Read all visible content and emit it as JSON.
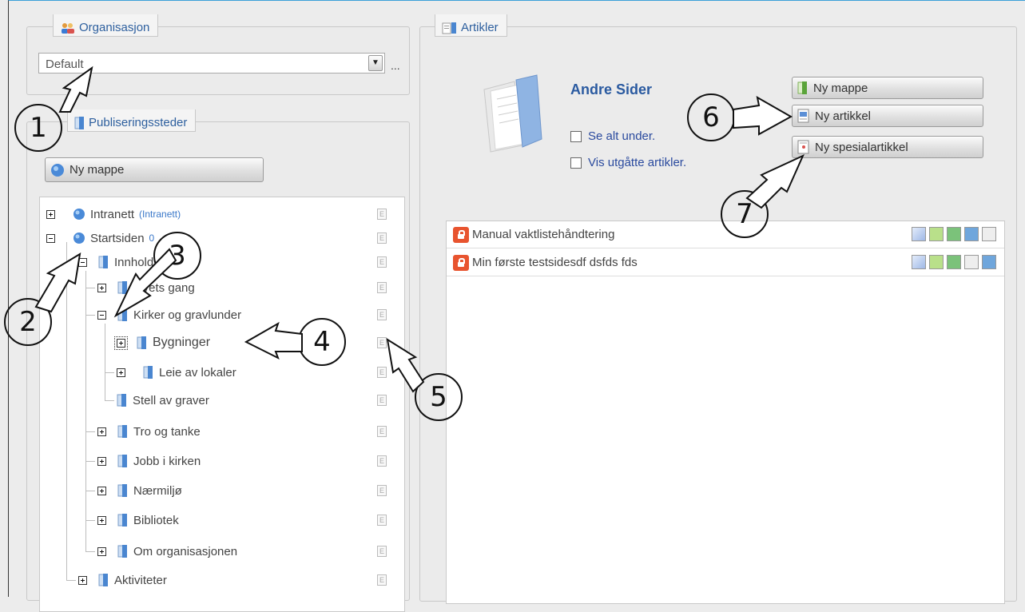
{
  "organisation": {
    "legend": "Organisasjon",
    "selected": "Default",
    "more": "..."
  },
  "publishing": {
    "legend": "Publiseringssteder",
    "new_folder_label": "Ny mappe",
    "tree": [
      {
        "label": "Intranett",
        "suffix": "(Intranett)",
        "toggle": "plus"
      },
      {
        "label": "Startsiden",
        "suffix": "0",
        "toggle": "minus"
      },
      {
        "label": "Innhold",
        "toggle": "minus"
      },
      {
        "label": "Livets gang",
        "toggle": "plus"
      },
      {
        "label": "Kirker og gravlunder",
        "toggle": "minus"
      },
      {
        "label": "Bygninger",
        "toggle": "plus"
      },
      {
        "label": "Leie av lokaler",
        "toggle": "plus"
      },
      {
        "label": "Stell av graver",
        "toggle": "none"
      },
      {
        "label": "Tro og tanke",
        "toggle": "plus"
      },
      {
        "label": "Jobb i kirken",
        "toggle": "plus"
      },
      {
        "label": "Nærmiljø",
        "toggle": "plus"
      },
      {
        "label": "Bibliotek",
        "toggle": "plus"
      },
      {
        "label": "Om organisasjonen",
        "toggle": "plus"
      },
      {
        "label": "Aktiviteter",
        "toggle": "plus"
      }
    ],
    "edit_marker": "E"
  },
  "articles": {
    "legend": "Artikler",
    "folder_title": "Andre Sider",
    "checkboxes": [
      {
        "label": "Se alt under.",
        "checked": false
      },
      {
        "label": "Vis utgåtte artikler.",
        "checked": false
      }
    ],
    "buttons": {
      "new_folder": "Ny mappe",
      "new_article": "Ny artikkel",
      "new_special": "Ny spesialartikkel"
    },
    "list": [
      {
        "title": "Manual vaktlistehåndtering"
      },
      {
        "title": "Min første testsidesdf dsfds fds"
      }
    ]
  },
  "annotations": [
    "1",
    "2",
    "3",
    "4",
    "5",
    "6",
    "7"
  ],
  "colors": {
    "accent_blue": "#2a5aa0",
    "legend_blue": "#2d5f9e",
    "lock_red": "#e8542f"
  }
}
